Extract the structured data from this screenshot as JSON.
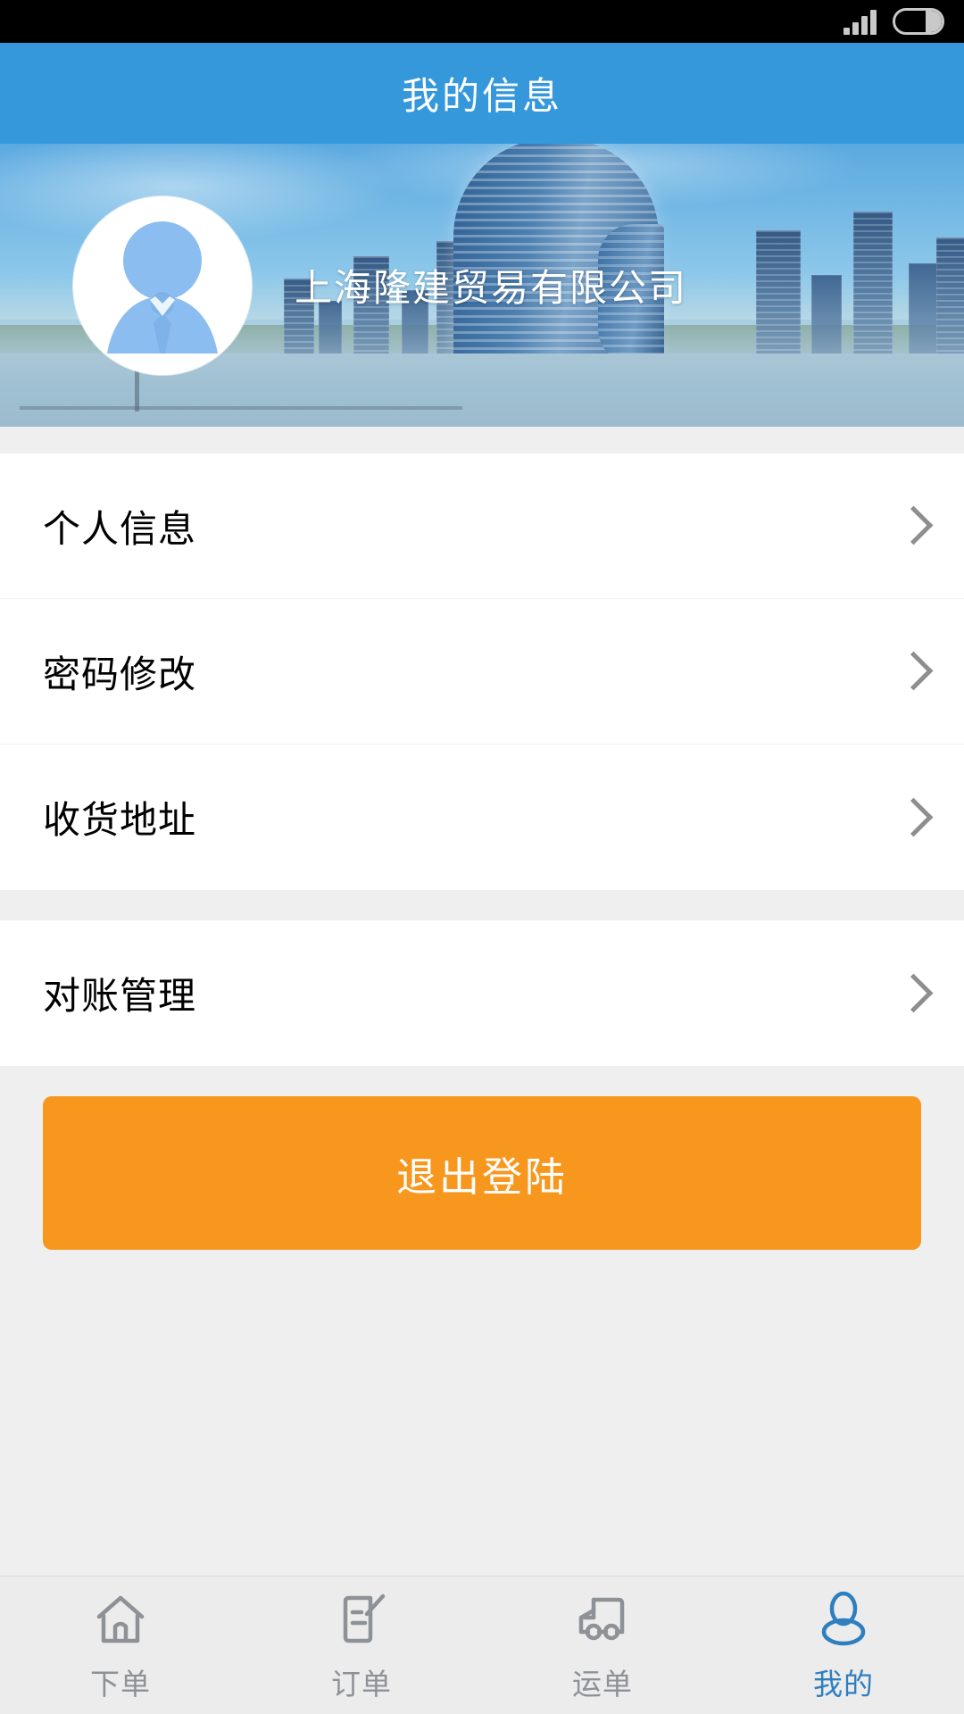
{
  "status_bar": {
    "signal_icon": "signal-bars-icon",
    "signal_bars": 4,
    "battery_icon": "battery-icon"
  },
  "header": {
    "title": "我的信息"
  },
  "profile": {
    "avatar_icon": "user-avatar-icon",
    "company_name": "上海隆建贸易有限公司"
  },
  "menu": {
    "group_one": [
      {
        "label": "个人信息",
        "chevron": "chevron-right-icon"
      },
      {
        "label": "密码修改",
        "chevron": "chevron-right-icon"
      },
      {
        "label": "收货地址",
        "chevron": "chevron-right-icon"
      }
    ],
    "group_two": [
      {
        "label": "对账管理",
        "chevron": "chevron-right-icon"
      }
    ]
  },
  "actions": {
    "logout_label": "退出登陆"
  },
  "tab_bar": {
    "items": [
      {
        "label": "下单",
        "icon": "home-icon",
        "active": false
      },
      {
        "label": "订单",
        "icon": "order-edit-icon",
        "active": false
      },
      {
        "label": "运单",
        "icon": "truck-icon",
        "active": false
      },
      {
        "label": "我的",
        "icon": "person-icon",
        "active": true
      }
    ]
  },
  "colors": {
    "header_blue": "#3498db",
    "accent_orange": "#f7971e",
    "active_tab_blue": "#2e7fc0",
    "page_background": "#efefef",
    "inactive_icon_gray": "#8e9196"
  }
}
